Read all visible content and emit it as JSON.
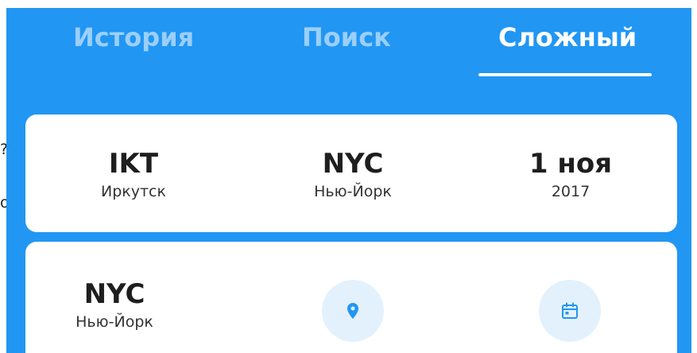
{
  "edge_fragments": [
    "?",
    "o"
  ],
  "tabs": [
    {
      "label": "История",
      "active": false
    },
    {
      "label": "Поиск",
      "active": false
    },
    {
      "label": "Сложный",
      "active": true
    }
  ],
  "route_card": {
    "origin": {
      "code": "IKT",
      "city": "Иркутск"
    },
    "destination": {
      "code": "NYC",
      "city": "Нью-Йорк"
    },
    "date": {
      "day": "1 ноя",
      "year": "2017"
    }
  },
  "next_leg_card": {
    "origin": {
      "code": "NYC",
      "city": "Нью-Йорк"
    },
    "destination_icon": "location-pin-icon",
    "date_icon": "calendar-icon"
  },
  "colors": {
    "header_blue": "#2196F3",
    "icon_blue": "#2196F3",
    "icon_circle_bg": "#E3F1FD",
    "card_bg": "#FFFFFF"
  }
}
